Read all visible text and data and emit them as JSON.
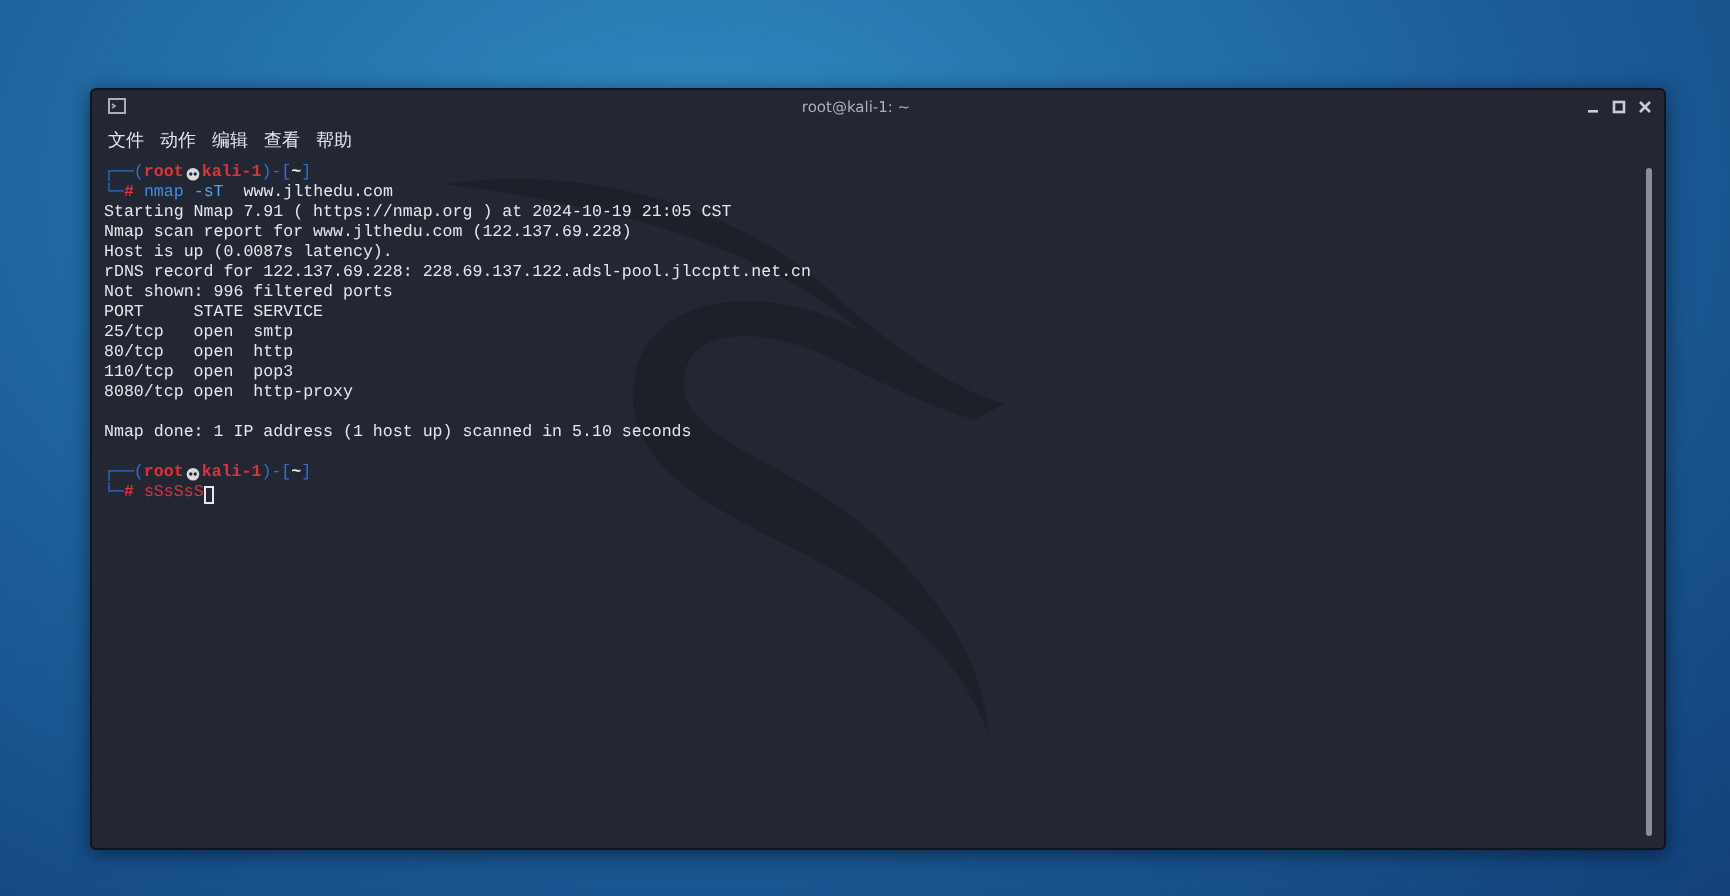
{
  "window": {
    "title": "root@kali-1: ~"
  },
  "menu": [
    "文件",
    "动作",
    "编辑",
    "查看",
    "帮助"
  ],
  "terminal": [
    {
      "kind": "prompt",
      "open": "┌──(",
      "user": "root",
      "host": "kali-1",
      "mid": ")-[",
      "dir": "~",
      "close": "]"
    },
    {
      "kind": "command",
      "lead": "└─",
      "symbol": "#",
      "name": "nmap",
      "args": "-sT",
      "target": "www.jlthedu.com",
      "valid": true,
      "cursor": false
    },
    {
      "kind": "output",
      "text": "Starting Nmap 7.91 ( https://nmap.org ) at 2024-10-19 21:05 CST"
    },
    {
      "kind": "output",
      "text": "Nmap scan report for www.jlthedu.com (122.137.69.228)"
    },
    {
      "kind": "output",
      "text": "Host is up (0.0087s latency)."
    },
    {
      "kind": "output",
      "text": "rDNS record for 122.137.69.228: 228.69.137.122.adsl-pool.jlccptt.net.cn"
    },
    {
      "kind": "output",
      "text": "Not shown: 996 filtered ports"
    },
    {
      "kind": "output",
      "text": "PORT     STATE SERVICE"
    },
    {
      "kind": "output",
      "text": "25/tcp   open  smtp"
    },
    {
      "kind": "output",
      "text": "80/tcp   open  http"
    },
    {
      "kind": "output",
      "text": "110/tcp  open  pop3"
    },
    {
      "kind": "output",
      "text": "8080/tcp open  http-proxy"
    },
    {
      "kind": "blank"
    },
    {
      "kind": "output",
      "text": "Nmap done: 1 IP address (1 host up) scanned in 5.10 seconds"
    },
    {
      "kind": "blank"
    },
    {
      "kind": "prompt",
      "open": "┌──(",
      "user": "root",
      "host": "kali-1",
      "mid": ")-[",
      "dir": "~",
      "close": "]"
    },
    {
      "kind": "command",
      "lead": "└─",
      "symbol": "#",
      "name": "sSsSsS",
      "valid": false,
      "cursor": true
    }
  ]
}
